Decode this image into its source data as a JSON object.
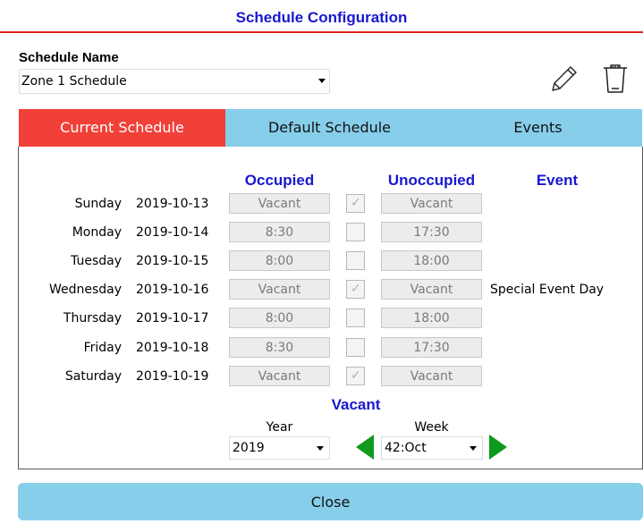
{
  "dialog": {
    "title": "Schedule Configuration"
  },
  "schedule": {
    "label": "Schedule Name",
    "selected": "Zone 1 Schedule"
  },
  "tabs": [
    {
      "label": "Current Schedule",
      "active": true
    },
    {
      "label": "Default Schedule",
      "active": false
    },
    {
      "label": "Events",
      "active": false
    }
  ],
  "columns": {
    "occupied": "Occupied",
    "unoccupied": "Unoccupied",
    "event": "Event"
  },
  "rows": [
    {
      "day": "Sunday",
      "date": "2019-10-13",
      "occupied": "Vacant",
      "vacant_checked": true,
      "unoccupied": "Vacant",
      "event": ""
    },
    {
      "day": "Monday",
      "date": "2019-10-14",
      "occupied": "8:30",
      "vacant_checked": false,
      "unoccupied": "17:30",
      "event": ""
    },
    {
      "day": "Tuesday",
      "date": "2019-10-15",
      "occupied": "8:00",
      "vacant_checked": false,
      "unoccupied": "18:00",
      "event": ""
    },
    {
      "day": "Wednesday",
      "date": "2019-10-16",
      "occupied": "Vacant",
      "vacant_checked": true,
      "unoccupied": "Vacant",
      "event": "Special Event Day"
    },
    {
      "day": "Thursday",
      "date": "2019-10-17",
      "occupied": "8:00",
      "vacant_checked": false,
      "unoccupied": "18:00",
      "event": ""
    },
    {
      "day": "Friday",
      "date": "2019-10-18",
      "occupied": "8:30",
      "vacant_checked": false,
      "unoccupied": "17:30",
      "event": ""
    },
    {
      "day": "Saturday",
      "date": "2019-10-19",
      "occupied": "Vacant",
      "vacant_checked": true,
      "unoccupied": "Vacant",
      "event": ""
    }
  ],
  "vacant_label": "Vacant",
  "year": {
    "label": "Year",
    "selected": "2019"
  },
  "week": {
    "label": "Week",
    "selected": "42:Oct"
  },
  "icons": {
    "edit": "pencil-icon",
    "delete": "trash-icon",
    "prev": "prev-week-arrow-icon",
    "next": "next-week-arrow-icon"
  },
  "colors": {
    "accent_blue": "#1818d0",
    "tab_active": "#f04038",
    "tab_bg": "#87ceeb",
    "arrow_green": "#0f9a1e",
    "title_rule": "#e02020"
  },
  "footer": {
    "close_label": "Close"
  }
}
